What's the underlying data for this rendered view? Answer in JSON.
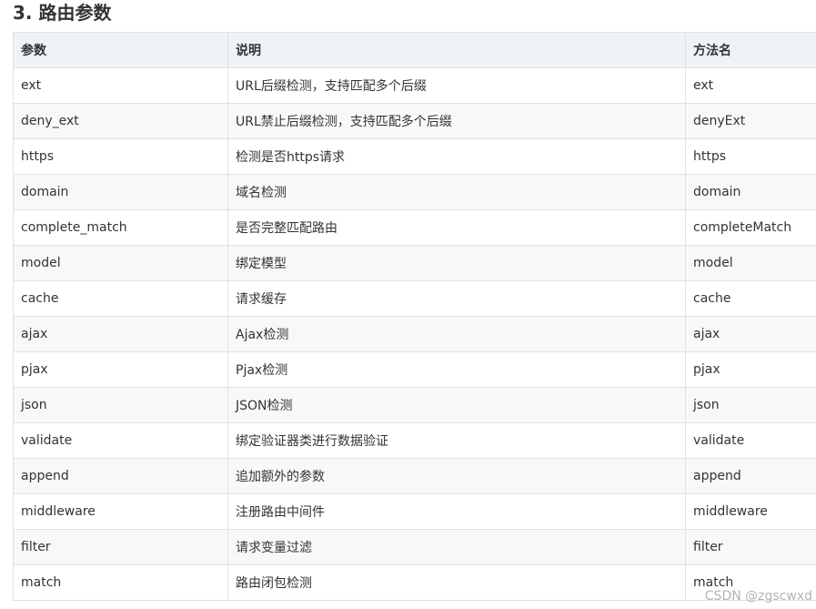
{
  "section": {
    "title": "3. 路由参数"
  },
  "table": {
    "headers": [
      "参数",
      "说明",
      "方法名"
    ],
    "rows": [
      [
        "ext",
        "URL后缀检测，支持匹配多个后缀",
        "ext"
      ],
      [
        "deny_ext",
        "URL禁止后缀检测，支持匹配多个后缀",
        "denyExt"
      ],
      [
        "https",
        "检测是否https请求",
        "https"
      ],
      [
        "domain",
        "域名检测",
        "domain"
      ],
      [
        "complete_match",
        "是否完整匹配路由",
        "completeMatch"
      ],
      [
        "model",
        "绑定模型",
        "model"
      ],
      [
        "cache",
        "请求缓存",
        "cache"
      ],
      [
        "ajax",
        "Ajax检测",
        "ajax"
      ],
      [
        "pjax",
        "Pjax检测",
        "pjax"
      ],
      [
        "json",
        "JSON检测",
        "json"
      ],
      [
        "validate",
        "绑定验证器类进行数据验证",
        "validate"
      ],
      [
        "append",
        "追加额外的参数",
        "append"
      ],
      [
        "middleware",
        "注册路由中间件",
        "middleware"
      ],
      [
        "filter",
        "请求变量过滤",
        "filter"
      ],
      [
        "match",
        "路由闭包检测",
        "match"
      ]
    ]
  },
  "watermark": "CSDN @zgscwxd"
}
